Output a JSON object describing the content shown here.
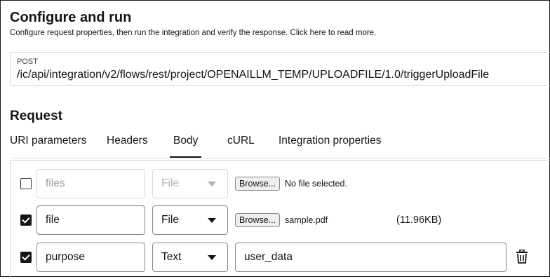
{
  "header": {
    "title": "Configure and run",
    "subtitle": "Configure request properties, then run the integration and verify the response. Click here to read more."
  },
  "endpoint": {
    "method": "POST",
    "url": "/ic/api/integration/v2/flows/rest/project/OPENAILLM_TEMP/UPLOADFILE/1.0/triggerUploadFile"
  },
  "request": {
    "title": "Request",
    "tabs": [
      {
        "label": "URI parameters",
        "active": false
      },
      {
        "label": "Headers",
        "active": false
      },
      {
        "label": "Body",
        "active": true
      },
      {
        "label": "cURL",
        "active": false
      },
      {
        "label": "Integration properties",
        "active": false
      }
    ]
  },
  "body_rows": [
    {
      "checked": false,
      "name": "files",
      "type": "File",
      "browse_label": "Browse...",
      "file_label": "No file selected.",
      "size": "",
      "enabled": false
    },
    {
      "checked": true,
      "name": "file",
      "type": "File",
      "browse_label": "Browse...",
      "file_label": "sample.pdf",
      "size": "(11.96KB)",
      "enabled": true
    },
    {
      "checked": true,
      "name": "purpose",
      "type": "Text",
      "value": "user_data",
      "enabled": true
    }
  ],
  "icons": {
    "delete": "trash-icon",
    "dropdown": "chevron-down-icon",
    "checkbox": "checkbox-icon"
  }
}
